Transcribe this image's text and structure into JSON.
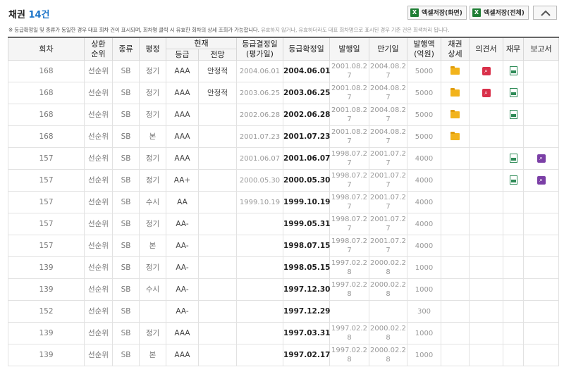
{
  "header": {
    "title_prefix": "채권",
    "count": "14건"
  },
  "buttons": {
    "excel_screen": "엑셀저장(화면)",
    "excel_all": "엑셀저장(전체)",
    "excel_glyph": "X"
  },
  "note": {
    "main": "※ 등급확정일 및 종류가 동일한 경우 대표 회차 건이 표시되며, 회차명 클릭 시 유효한 회차의 상세 조회가 가능합니다.",
    "gray": "유효하지 않거나, 유효하더라도 대표 회차명으로 표시된 경우 기준 건은 회색처리 됩니다."
  },
  "columns": {
    "round": "회차",
    "priority": "상환\n순위",
    "kind": "종류",
    "eval": "평정",
    "current": "현재",
    "grade": "등급",
    "outlook": "전망",
    "decision": "등급결정일\n(평가일)",
    "confirm": "등급확정일",
    "issue": "발행일",
    "maturity": "만기일",
    "amount": "발행액\n(억원)",
    "detail": "채권\n상세",
    "opinion": "의견서",
    "finance": "재무",
    "report": "보고서"
  },
  "icons": {
    "folder": "folder-icon",
    "opinion": "search-doc-icon",
    "finance": "excel-doc-icon",
    "report": "report-search-icon"
  },
  "colors": {
    "count": "#1a73c8",
    "folder": "#f2b31b",
    "opinion": "#d9304a",
    "finance": "#2e8b57",
    "report": "#7b3fa6"
  },
  "rows": [
    {
      "round": "168",
      "priority": "선순위",
      "kind": "SB",
      "eval": "정기",
      "grade": "AAA",
      "outlook": "안정적",
      "decision": "2004.06.01",
      "confirm": "2004.06.01",
      "issue": "2001.08.2\n7",
      "maturity": "2004.08.2\n7",
      "amount": "5000",
      "detail": true,
      "opinion": true,
      "finance": true,
      "report": false
    },
    {
      "round": "168",
      "priority": "선순위",
      "kind": "SB",
      "eval": "정기",
      "grade": "AAA",
      "outlook": "안정적",
      "decision": "2003.06.25",
      "confirm": "2003.06.25",
      "issue": "2001.08.2\n7",
      "maturity": "2004.08.2\n7",
      "amount": "5000",
      "detail": true,
      "opinion": true,
      "finance": true,
      "report": false
    },
    {
      "round": "168",
      "priority": "선순위",
      "kind": "SB",
      "eval": "정기",
      "grade": "AAA",
      "outlook": "",
      "decision": "2002.06.28",
      "confirm": "2002.06.28",
      "issue": "2001.08.2\n7",
      "maturity": "2004.08.2\n7",
      "amount": "5000",
      "detail": true,
      "opinion": false,
      "finance": true,
      "report": false
    },
    {
      "round": "168",
      "priority": "선순위",
      "kind": "SB",
      "eval": "본",
      "grade": "AAA",
      "outlook": "",
      "decision": "2001.07.23",
      "confirm": "2001.07.23",
      "issue": "2001.08.2\n7",
      "maturity": "2004.08.2\n7",
      "amount": "5000",
      "detail": true,
      "opinion": false,
      "finance": false,
      "report": false
    },
    {
      "round": "157",
      "priority": "선순위",
      "kind": "SB",
      "eval": "정기",
      "grade": "AAA",
      "outlook": "",
      "decision": "2001.06.07",
      "confirm": "2001.06.07",
      "issue": "1998.07.2\n7",
      "maturity": "2001.07.2\n7",
      "amount": "4000",
      "detail": false,
      "opinion": false,
      "finance": true,
      "report": true
    },
    {
      "round": "157",
      "priority": "선순위",
      "kind": "SB",
      "eval": "정기",
      "grade": "AA+",
      "outlook": "",
      "decision": "2000.05.30",
      "confirm": "2000.05.30",
      "issue": "1998.07.2\n7",
      "maturity": "2001.07.2\n7",
      "amount": "4000",
      "detail": false,
      "opinion": false,
      "finance": true,
      "report": true
    },
    {
      "round": "157",
      "priority": "선순위",
      "kind": "SB",
      "eval": "수시",
      "grade": "AA",
      "outlook": "",
      "decision": "1999.10.19",
      "confirm": "1999.10.19",
      "issue": "1998.07.2\n7",
      "maturity": "2001.07.2\n7",
      "amount": "4000",
      "detail": false,
      "opinion": false,
      "finance": false,
      "report": false
    },
    {
      "round": "157",
      "priority": "선순위",
      "kind": "SB",
      "eval": "정기",
      "grade": "AA-",
      "outlook": "",
      "decision": "",
      "confirm": "1999.05.31",
      "issue": "1998.07.2\n7",
      "maturity": "2001.07.2\n7",
      "amount": "4000",
      "detail": false,
      "opinion": false,
      "finance": false,
      "report": false
    },
    {
      "round": "157",
      "priority": "선순위",
      "kind": "SB",
      "eval": "본",
      "grade": "AA-",
      "outlook": "",
      "decision": "",
      "confirm": "1998.07.15",
      "issue": "1998.07.2\n7",
      "maturity": "2001.07.2\n7",
      "amount": "4000",
      "detail": false,
      "opinion": false,
      "finance": false,
      "report": false
    },
    {
      "round": "139",
      "priority": "선순위",
      "kind": "SB",
      "eval": "정기",
      "grade": "AA-",
      "outlook": "",
      "decision": "",
      "confirm": "1998.05.15",
      "issue": "1997.02.2\n8",
      "maturity": "2000.02.2\n8",
      "amount": "1000",
      "detail": false,
      "opinion": false,
      "finance": false,
      "report": false
    },
    {
      "round": "139",
      "priority": "선순위",
      "kind": "SB",
      "eval": "수시",
      "grade": "AA-",
      "outlook": "",
      "decision": "",
      "confirm": "1997.12.30",
      "issue": "1997.02.2\n8",
      "maturity": "2000.02.2\n8",
      "amount": "1000",
      "detail": false,
      "opinion": false,
      "finance": false,
      "report": false
    },
    {
      "round": "152",
      "priority": "선순위",
      "kind": "SB",
      "eval": "",
      "grade": "AA-",
      "outlook": "",
      "decision": "",
      "confirm": "1997.12.29",
      "issue": "",
      "maturity": "",
      "amount": "300",
      "detail": false,
      "opinion": false,
      "finance": false,
      "report": false
    },
    {
      "round": "139",
      "priority": "선순위",
      "kind": "SB",
      "eval": "정기",
      "grade": "AAA",
      "outlook": "",
      "decision": "",
      "confirm": "1997.03.31",
      "issue": "1997.02.2\n8",
      "maturity": "2000.02.2\n8",
      "amount": "1000",
      "detail": false,
      "opinion": false,
      "finance": false,
      "report": false
    },
    {
      "round": "139",
      "priority": "선순위",
      "kind": "SB",
      "eval": "본",
      "grade": "AAA",
      "outlook": "",
      "decision": "",
      "confirm": "1997.02.17",
      "issue": "1997.02.2\n8",
      "maturity": "2000.02.2\n8",
      "amount": "1000",
      "detail": false,
      "opinion": false,
      "finance": false,
      "report": false
    }
  ]
}
